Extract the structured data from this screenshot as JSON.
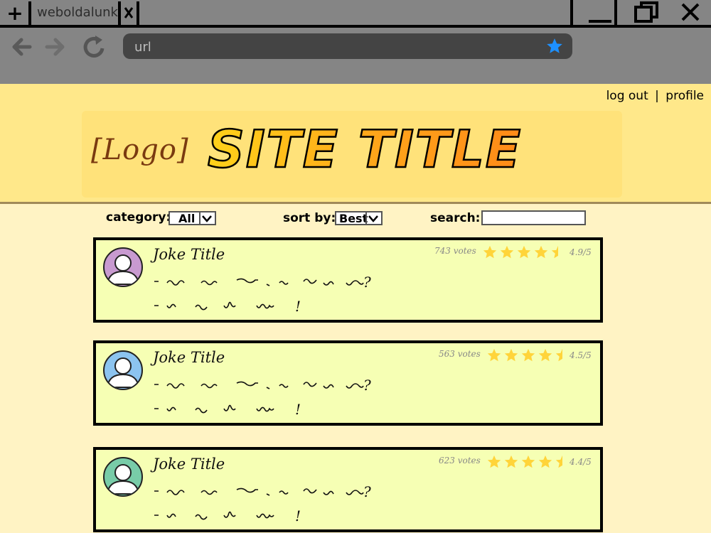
{
  "browser": {
    "tab_title": "weboldalunk",
    "new_tab_label": "+",
    "url_placeholder": "url"
  },
  "header": {
    "log_out": "log out",
    "separator": "|",
    "profile": "profile",
    "logo": "[Logo]",
    "site_title": "SITE TITLE"
  },
  "filters": {
    "category_label": "category:",
    "category_value": "All",
    "sort_label": "sort by:",
    "sort_value": "Best",
    "search_label": "search:"
  },
  "jokes": [
    {
      "title": "Joke Title",
      "votes": "743 votes",
      "rating_text": "4.9/5",
      "rating": 4.9,
      "avatar_color": "#c89ad0"
    },
    {
      "title": "Joke Title",
      "votes": "563 votes",
      "rating_text": "4.5/5",
      "rating": 4.5,
      "avatar_color": "#8cc4f0"
    },
    {
      "title": "Joke Title",
      "votes": "623 votes",
      "rating_text": "4.4/5",
      "rating": 4.4,
      "avatar_color": "#78cca8"
    }
  ],
  "colors": {
    "star": "#ffd43a",
    "url_star": "#1e90ff"
  }
}
